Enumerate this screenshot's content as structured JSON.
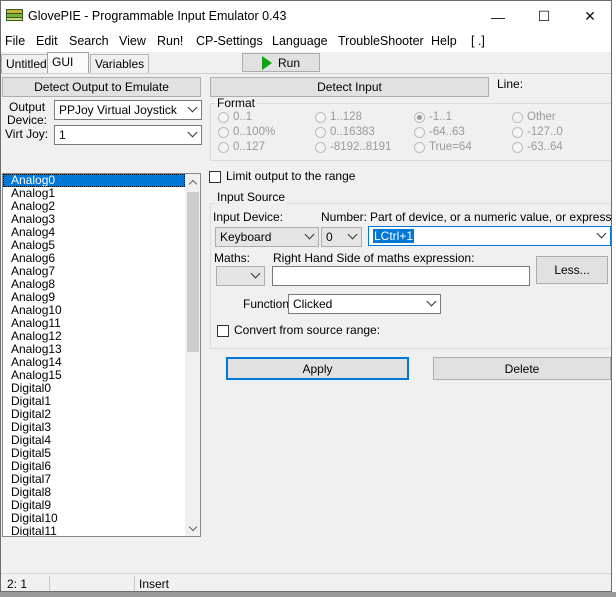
{
  "window": {
    "title": "GlovePIE - Programmable Input Emulator 0.43",
    "minimize_glyph": "—",
    "maximize_glyph": "☐",
    "close_glyph": "✕"
  },
  "menu": [
    "File",
    "Edit",
    "Search",
    "View",
    "Run!",
    "CP-Settings",
    "Language",
    "TroubleShooter",
    "Help",
    "[ .]"
  ],
  "tabs": [
    {
      "label": "Untitled",
      "active": false
    },
    {
      "label": "GUI",
      "active": true
    },
    {
      "label": "Variables",
      "active": false
    }
  ],
  "run_button": {
    "label": "Run"
  },
  "left": {
    "detect_output_label": "Detect Output to Emulate",
    "output_device_label_1": "Output",
    "output_device_label_2": "Device:",
    "output_device_value": "PPJoy Virtual Joystick",
    "virt_joy_label": "Virt Joy:",
    "virt_joy_value": "1"
  },
  "list_items": [
    "Analog0",
    "Analog1",
    "Analog2",
    "Analog3",
    "Analog4",
    "Analog5",
    "Analog6",
    "Analog7",
    "Analog8",
    "Analog9",
    "Analog10",
    "Analog11",
    "Analog12",
    "Analog13",
    "Analog14",
    "Analog15",
    "Digital0",
    "Digital1",
    "Digital2",
    "Digital3",
    "Digital4",
    "Digital5",
    "Digital6",
    "Digital7",
    "Digital8",
    "Digital9",
    "Digital10",
    "Digital11"
  ],
  "selected_item": "Analog0",
  "right": {
    "detect_input_label": "Detect Input",
    "line_label": "Line:",
    "format_title": "Format",
    "format_options": [
      "0..1",
      "1..128",
      "-1..1",
      "Other",
      "0..100%",
      "0..16383",
      "-64..63",
      "-127..0",
      "0..127",
      "-8192..8191",
      "True=64",
      "-63..64"
    ],
    "format_selected": "-1..1",
    "limit_label": "Limit output to the range",
    "input_source_title": "Input Source",
    "input_device_label": "Input Device:",
    "input_device_value": "Keyboard",
    "number_label": "Number:",
    "number_value": "0",
    "part_label": "Part of device,  or a numeric value, or expression:",
    "part_value": "LCtrl+1",
    "maths_label": "Maths:",
    "maths_value": "",
    "rhs_label": "Right Hand Side of maths expression:",
    "rhs_value": "",
    "less_label": "Less...",
    "function_label": "Function:",
    "function_value": "Clicked",
    "convert_label": "Convert from source range:",
    "apply_label": "Apply",
    "delete_label": "Delete"
  },
  "status": {
    "position": "2:  1",
    "mode": "Insert"
  }
}
